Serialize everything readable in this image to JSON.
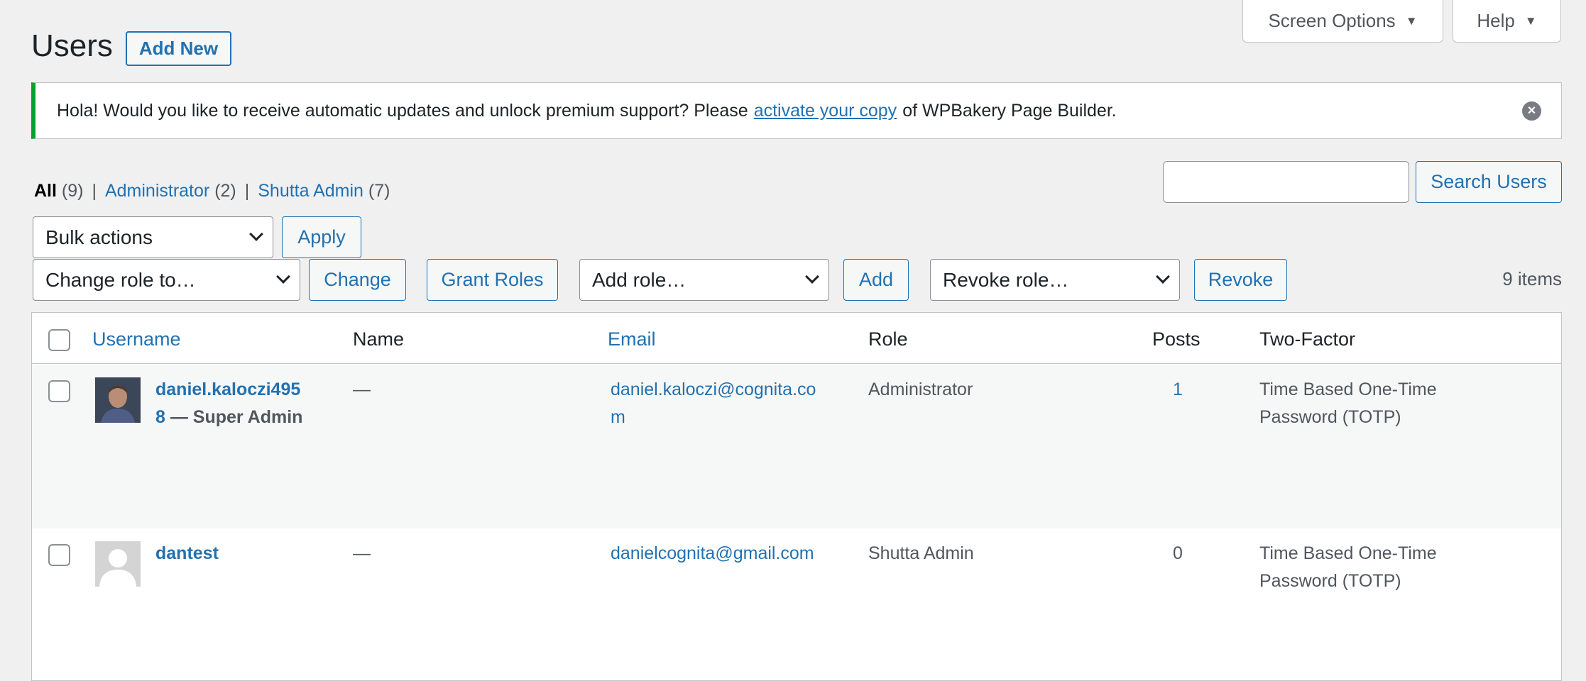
{
  "top_tabs": {
    "screen_options": "Screen Options",
    "help": "Help"
  },
  "header": {
    "title": "Users",
    "add_new": "Add New"
  },
  "notice": {
    "text_before": "Hola! Would you like to receive automatic updates and unlock premium support? Please",
    "link": "activate your copy",
    "text_after": "of WPBakery Page Builder.",
    "status_color": "#00a32a"
  },
  "filters": {
    "all_label": "All",
    "all_count": "(9)",
    "admin_label": "Administrator",
    "admin_count": "(2)",
    "shutta_label": "Shutta Admin",
    "shutta_count": "(7)",
    "separator": "|"
  },
  "search": {
    "value": "",
    "button": "Search Users"
  },
  "bulk": {
    "select_value": "Bulk actions",
    "apply": "Apply"
  },
  "roles": {
    "change_select": "Change role to…",
    "change_button": "Change",
    "grant_button": "Grant Roles",
    "add_select": "Add role…",
    "add_button": "Add",
    "revoke_select": "Revoke role…",
    "revoke_button": "Revoke"
  },
  "items_count": "9 items",
  "table": {
    "columns": {
      "username": "Username",
      "name": "Name",
      "email": "Email",
      "role": "Role",
      "posts": "Posts",
      "two_factor": "Two-Factor"
    },
    "rows": [
      {
        "username_line1": "daniel.kaloczi495",
        "username_line2": "8",
        "suffix": "— Super Admin",
        "name": "—",
        "email_line1": "daniel.kaloczi@cognita.co",
        "email_line2": "m",
        "role": "Administrator",
        "posts": "1",
        "tf_line1": "Time Based One-Time",
        "tf_line2": "Password (TOTP)",
        "avatar": "photo"
      },
      {
        "username_line1": "dantest",
        "name": "—",
        "email_line1": "danielcognita@gmail.com",
        "role": "Shutta Admin",
        "posts": "0",
        "tf_line1": "Time Based One-Time",
        "tf_line2": "Password (TOTP)",
        "avatar": "default"
      }
    ]
  },
  "colors": {
    "link": "#2271b1",
    "background": "#f0f0f1"
  }
}
